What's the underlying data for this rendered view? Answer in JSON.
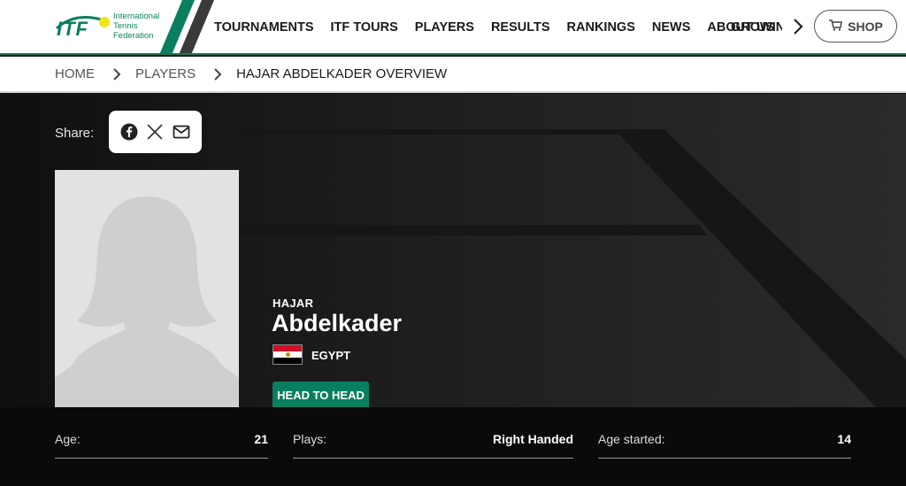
{
  "logo": {
    "brand": "ITF",
    "line1": "International",
    "line2": "Tennis",
    "line3": "Federation"
  },
  "nav": {
    "items": [
      "TOURNAMENTS",
      "ITF TOURS",
      "PLAYERS",
      "RESULTS",
      "RANKINGS",
      "NEWS",
      "ABOUT US"
    ],
    "clipped_item": "GROWIN",
    "next_icon": "chevron-right-icon",
    "shop_label": "SHOP",
    "shop_icon": "cart-icon"
  },
  "breadcrumb": {
    "home": "HOME",
    "players": "PLAYERS",
    "current": "HAJAR ABDELKADER OVERVIEW"
  },
  "share": {
    "label": "Share:",
    "icons": [
      "facebook-icon",
      "x-icon",
      "mail-icon"
    ]
  },
  "player": {
    "first_name": "HAJAR",
    "last_name": "Abdelkader",
    "country": "EGYPT",
    "h2h_label": "HEAD TO HEAD",
    "photo": "placeholder-silhouette"
  },
  "stats": [
    {
      "label": "Age:",
      "value": "21"
    },
    {
      "label": "Plays:",
      "value": "Right Handed"
    },
    {
      "label": "Age started:",
      "value": "14"
    }
  ],
  "colors": {
    "brand_green": "#0a7f5f",
    "logo_ball": "#f2e21a",
    "hero_dark": "#1e1e1e",
    "stats_bg": "#0a0a0a"
  }
}
